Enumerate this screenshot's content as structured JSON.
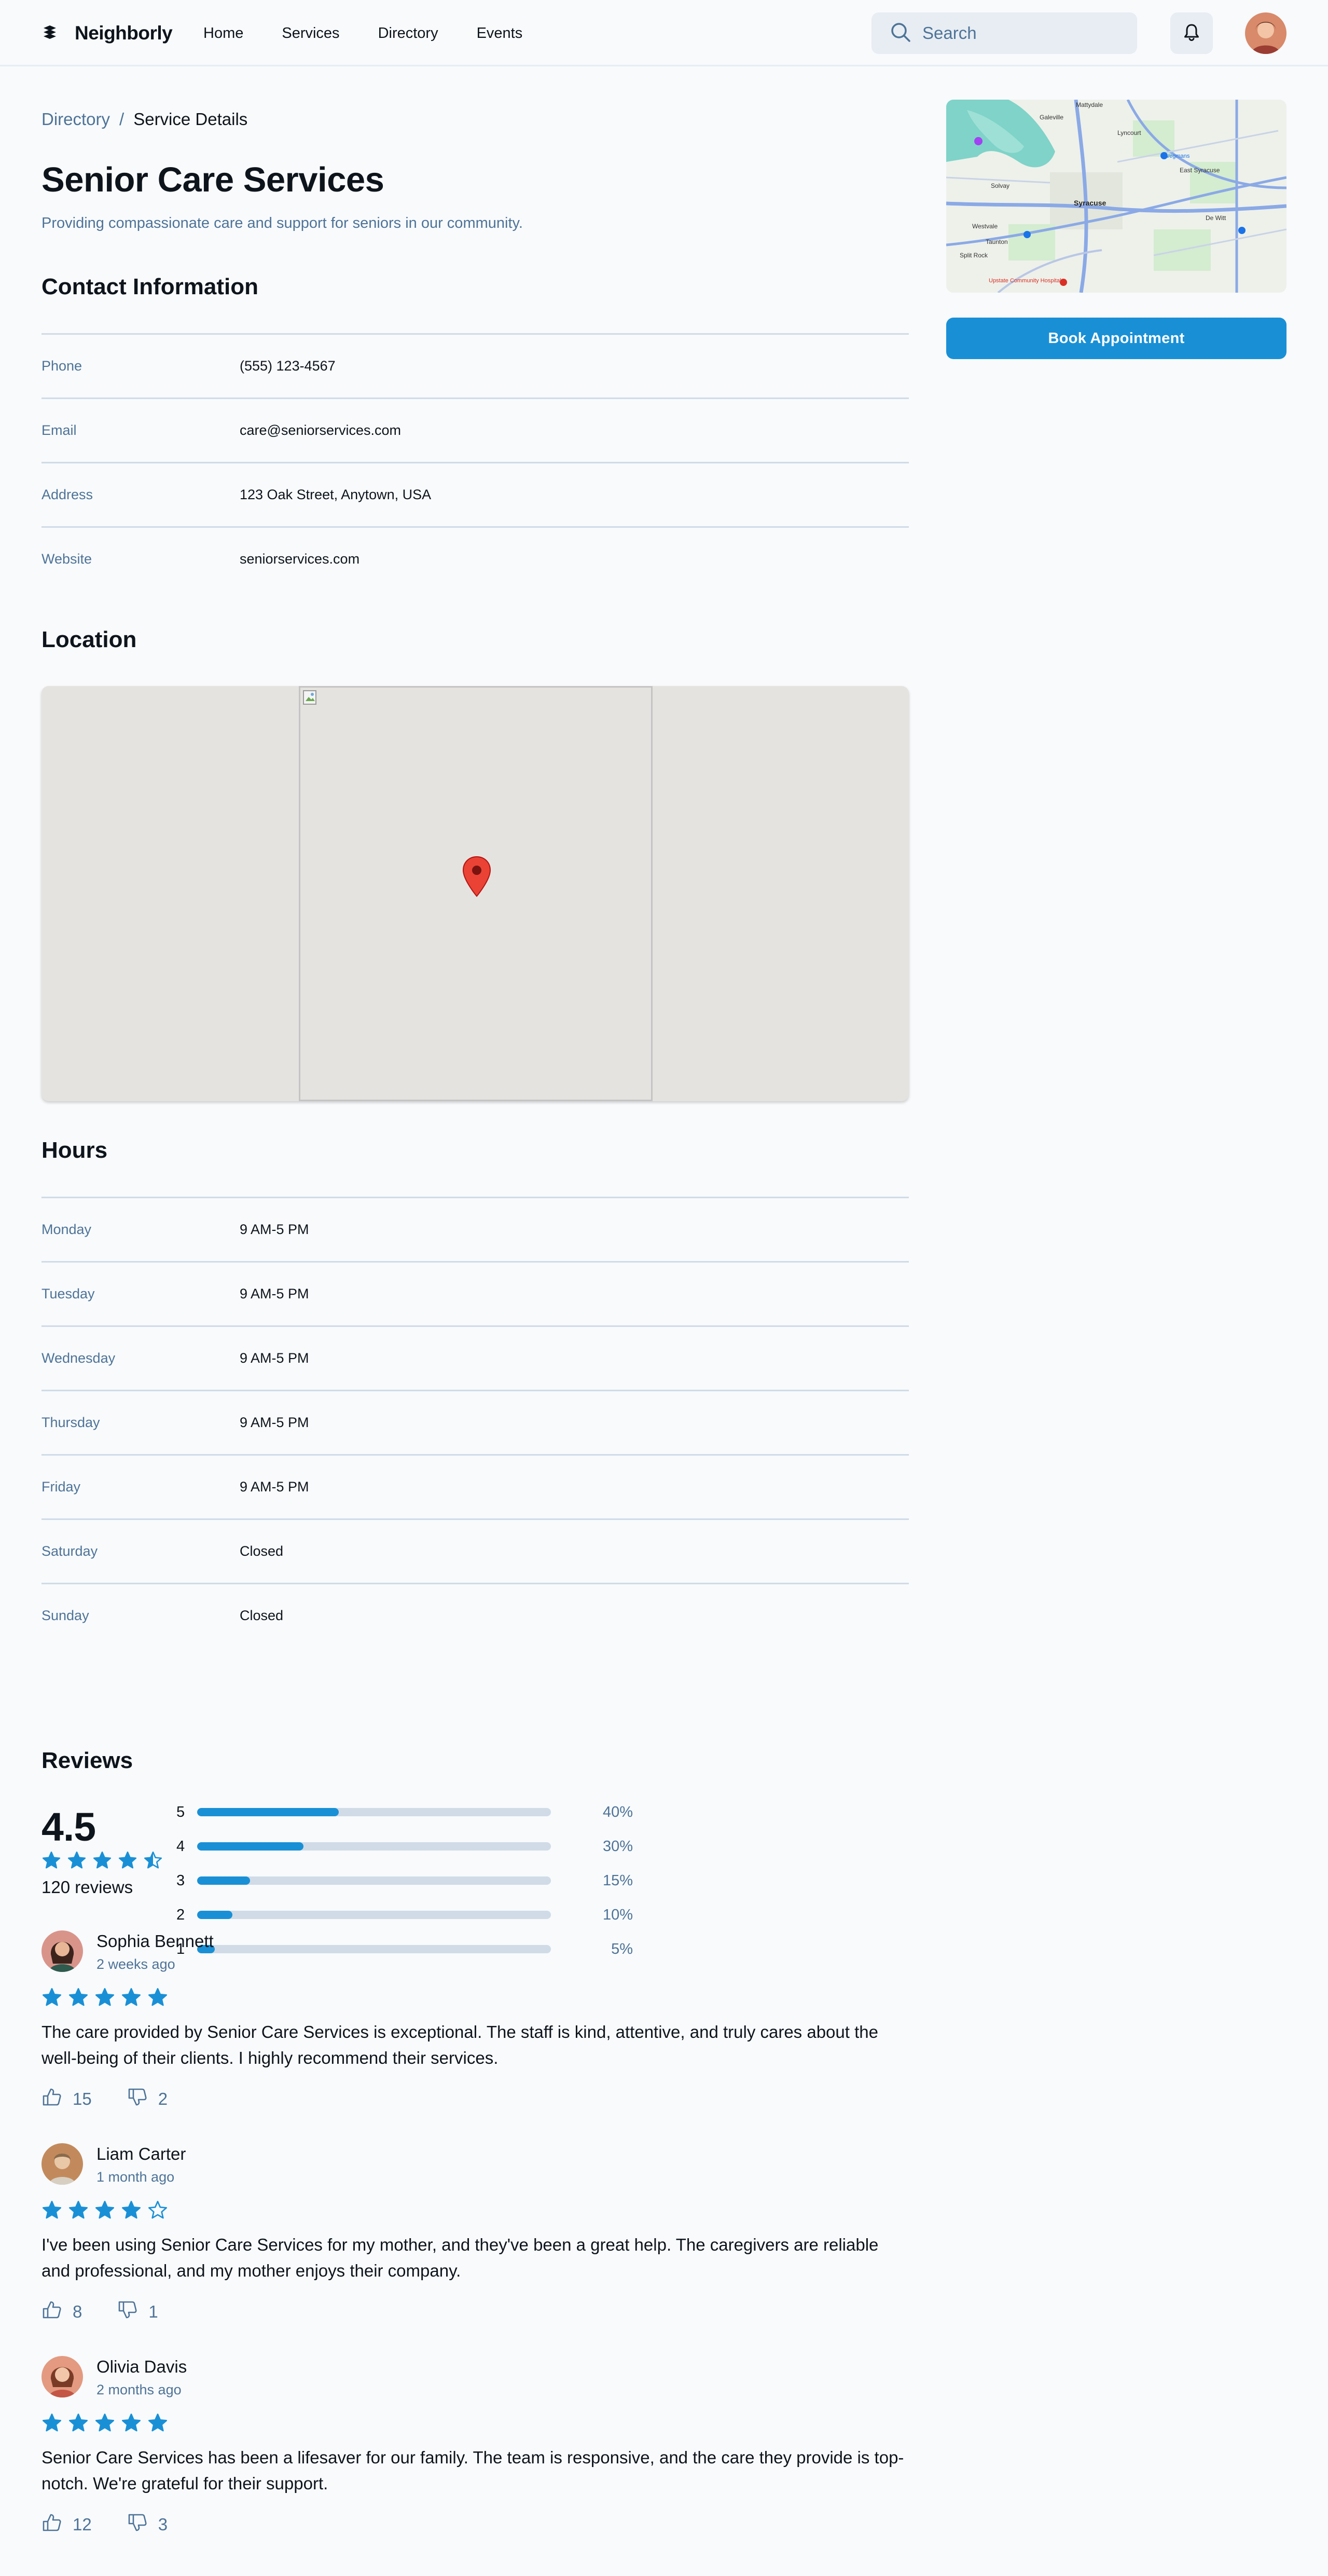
{
  "header": {
    "brand": "Neighborly",
    "nav": [
      "Home",
      "Services",
      "Directory",
      "Events"
    ],
    "search_placeholder": "Search"
  },
  "breadcrumb": {
    "link": "Directory",
    "separator": "/",
    "current": "Service Details"
  },
  "title": "Senior Care Services",
  "subtitle": "Providing compassionate care and support for seniors in our community.",
  "contact": {
    "title": "Contact Information",
    "rows": [
      {
        "key": "Phone",
        "value": "(555) 123-4567"
      },
      {
        "key": "Email",
        "value": "care@seniorservices.com"
      },
      {
        "key": "Address",
        "value": "123 Oak Street, Anytown, USA"
      },
      {
        "key": "Website",
        "value": "seniorservices.com"
      }
    ]
  },
  "location": {
    "title": "Location"
  },
  "hours": {
    "title": "Hours",
    "rows": [
      {
        "key": "Monday",
        "value": "9 AM-5 PM"
      },
      {
        "key": "Tuesday",
        "value": "9 AM-5 PM"
      },
      {
        "key": "Wednesday",
        "value": "9 AM-5 PM"
      },
      {
        "key": "Thursday",
        "value": "9 AM-5 PM"
      },
      {
        "key": "Friday",
        "value": "9 AM-5 PM"
      },
      {
        "key": "Saturday",
        "value": "Closed"
      },
      {
        "key": "Sunday",
        "value": "Closed"
      }
    ]
  },
  "reviews": {
    "title": "Reviews",
    "average": "4.5",
    "average_stars": 4.5,
    "count_label": "120 reviews",
    "distribution": [
      {
        "stars": "5",
        "percent": 40,
        "label": "40%"
      },
      {
        "stars": "4",
        "percent": 30,
        "label": "30%"
      },
      {
        "stars": "3",
        "percent": 15,
        "label": "15%"
      },
      {
        "stars": "2",
        "percent": 10,
        "label": "10%"
      },
      {
        "stars": "1",
        "percent": 5,
        "label": "5%"
      }
    ],
    "items": [
      {
        "name": "Sophia Bennett",
        "date": "2 weeks ago",
        "rating": 5,
        "text": "The care provided by Senior Care Services is exceptional. The staff is kind, attentive, and truly cares about the well-being of their clients. I highly recommend their services.",
        "likes": "15",
        "dislikes": "2"
      },
      {
        "name": "Liam Carter",
        "date": "1 month ago",
        "rating": 4,
        "text": "I've been using Senior Care Services for my mother, and they've been a great help. The caregivers are reliable and professional, and my mother enjoys their company.",
        "likes": "8",
        "dislikes": "1"
      },
      {
        "name": "Olivia Davis",
        "date": "2 months ago",
        "rating": 5,
        "text": "Senior Care Services has been a lifesaver for our family. The team is responsive, and the care they provide is top-notch. We're grateful for their support.",
        "likes": "12",
        "dislikes": "3"
      }
    ]
  },
  "sidebar": {
    "map_labels": [
      "Mattydale",
      "Galeville",
      "Lyncourt",
      "Solvay",
      "East Syracuse",
      "Syracuse",
      "Westvale",
      "De Witt",
      "Taunton",
      "Split Rock",
      "Wegmans",
      "Upstate Community Hospital"
    ],
    "book_label": "Book Appointment"
  },
  "colors": {
    "accent": "#1990d6",
    "muted_text": "#4e7397",
    "divider": "#d0dbe7",
    "pin": "#ea4335"
  }
}
